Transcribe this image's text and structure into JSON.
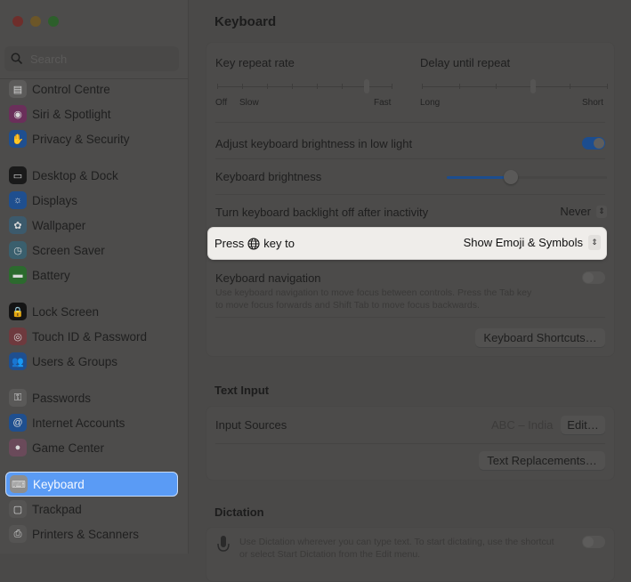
{
  "window": {
    "traffic_lights": [
      "close",
      "minimize",
      "zoom"
    ]
  },
  "sidebar": {
    "search_placeholder": "Search",
    "items": [
      {
        "label": "Control Centre",
        "icon": "control-centre-icon",
        "color": "#5c5b5a",
        "glyph": "▤"
      },
      {
        "label": "Siri & Spotlight",
        "icon": "siri-icon",
        "color": "#6a2f5a",
        "glyph": "◉"
      },
      {
        "label": "Privacy & Security",
        "icon": "hand-icon",
        "color": "#1f4f8f",
        "glyph": "✋"
      },
      {
        "label": "Desktop & Dock",
        "icon": "desktop-dock-icon",
        "color": "#1a1a1a",
        "glyph": "▭"
      },
      {
        "label": "Displays",
        "icon": "displays-icon",
        "color": "#1f4f8f",
        "glyph": "☼"
      },
      {
        "label": "Wallpaper",
        "icon": "wallpaper-icon",
        "color": "#3c5a6c",
        "glyph": "✿"
      },
      {
        "label": "Screen Saver",
        "icon": "screen-saver-icon",
        "color": "#3a5f6d",
        "glyph": "◷"
      },
      {
        "label": "Battery",
        "icon": "battery-icon",
        "color": "#2c6a2e",
        "glyph": "▬"
      },
      {
        "label": "Lock Screen",
        "icon": "lock-icon",
        "color": "#141414",
        "glyph": "🔒"
      },
      {
        "label": "Touch ID & Password",
        "icon": "fingerprint-icon",
        "color": "#6e3a3e",
        "glyph": "◎"
      },
      {
        "label": "Users & Groups",
        "icon": "users-icon",
        "color": "#1f4f8f",
        "glyph": "👥"
      },
      {
        "label": "Passwords",
        "icon": "key-icon",
        "color": "#5a5958",
        "glyph": "⚿"
      },
      {
        "label": "Internet Accounts",
        "icon": "at-icon",
        "color": "#1f4f8f",
        "glyph": "@"
      },
      {
        "label": "Game Center",
        "icon": "game-center-icon",
        "color": "#6a4a5a",
        "glyph": "●"
      },
      {
        "label": "Keyboard",
        "icon": "keyboard-icon",
        "color": "#8e8e8e",
        "glyph": "⌨",
        "active": true
      },
      {
        "label": "Trackpad",
        "icon": "trackpad-icon",
        "color": "#555453",
        "glyph": "▢"
      },
      {
        "label": "Printers & Scanners",
        "icon": "printer-icon",
        "color": "#555453",
        "glyph": "⎙"
      }
    ]
  },
  "main": {
    "title": "Keyboard",
    "key_repeat": {
      "label": "Key repeat rate",
      "min_labels": [
        "Off",
        "Slow"
      ],
      "max_label": "Fast",
      "ticks": 8,
      "value_index": 6
    },
    "delay_repeat": {
      "label": "Delay until repeat",
      "min_label": "Long",
      "max_label": "Short",
      "ticks": 6,
      "value_index": 3
    },
    "adjust_brightness": {
      "label": "Adjust keyboard brightness in low light",
      "on": true
    },
    "keyboard_brightness": {
      "label": "Keyboard brightness",
      "value_fraction": 0.4
    },
    "backlight_off": {
      "label": "Turn keyboard backlight off after inactivity",
      "value": "Never"
    },
    "press_globe": {
      "label_before": "Press",
      "label_after": "key to",
      "value": "Show Emoji & Symbols"
    },
    "keyboard_navigation": {
      "label": "Keyboard navigation",
      "description_line1": "Use keyboard navigation to move focus between controls. Press the Tab key",
      "description_line2": "to move focus forwards and Shift Tab to move focus backwards.",
      "on": false
    },
    "keyboard_shortcuts_button": "Keyboard Shortcuts…",
    "text_input": {
      "heading": "Text Input",
      "input_sources_label": "Input Sources",
      "input_sources_value": "ABC – India",
      "edit_button": "Edit…",
      "text_replacements_button": "Text Replacements…"
    },
    "dictation": {
      "heading": "Dictation",
      "description": "Use Dictation wherever you can type text. To start dictating, use the shortcut",
      "description_line2": "or select Start Dictation from the Edit menu.",
      "on": false
    }
  },
  "colors": {
    "accent": "#5a9bf5",
    "toggle_on": "#1c4d8f",
    "highlight_bg": "#efedea"
  }
}
